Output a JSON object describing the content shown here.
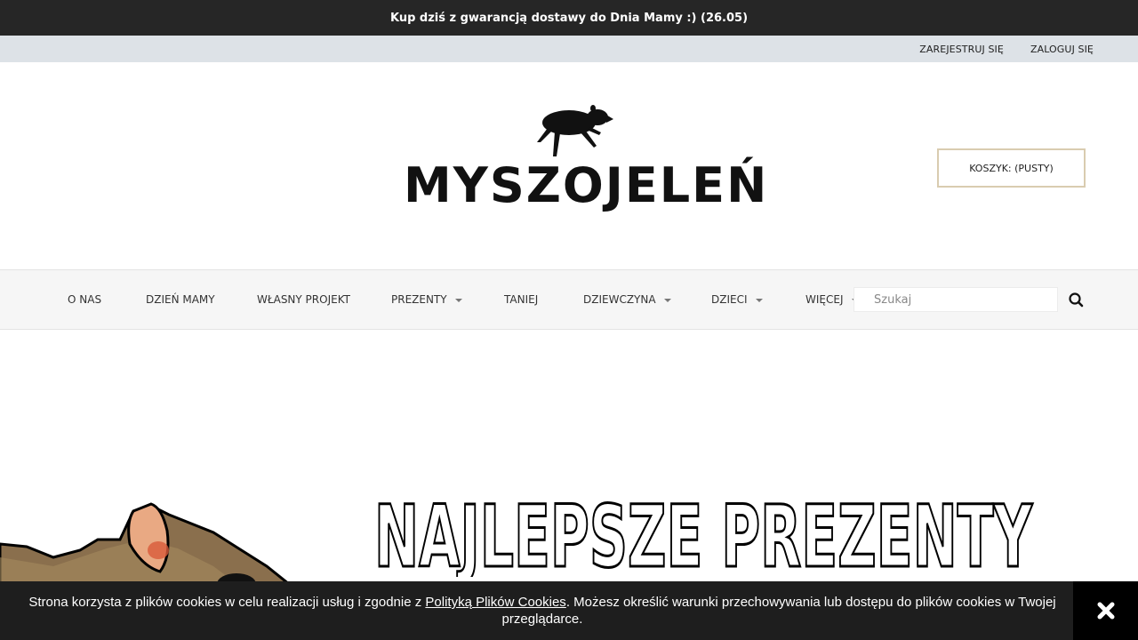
{
  "promo": {
    "text": "Kup dziś z gwarancją dostawy do Dnia Mamy :) (26.05)"
  },
  "account": {
    "register": "ZAREJESTRUJ SIĘ",
    "login": "ZALOGUJ SIĘ"
  },
  "header": {
    "logo_text": "MYSZOJELEŃ",
    "cart_label": "KOSZYK: (PUSTY)"
  },
  "nav": {
    "items": [
      {
        "label": "O NAS",
        "has_dropdown": false
      },
      {
        "label": "DZIEŃ MAMY",
        "has_dropdown": false
      },
      {
        "label": "WŁASNY PROJEKT",
        "has_dropdown": false
      },
      {
        "label": "PREZENTY",
        "has_dropdown": true
      },
      {
        "label": "TANIEJ",
        "has_dropdown": false
      },
      {
        "label": "DZIEWCZYNA",
        "has_dropdown": true
      },
      {
        "label": "DZIECI",
        "has_dropdown": true
      },
      {
        "label": "WIĘCEJ",
        "has_dropdown": true
      }
    ],
    "search_placeholder": "Szukaj",
    "search_icon": "search-icon"
  },
  "hero": {
    "headline": "NAJLEPSZE PREZENTY"
  },
  "cookie": {
    "text_before": "Strona korzysta z plików cookies w celu realizacji usług i zgodnie z ",
    "link_text": "Polityką Plików Cookies",
    "text_after": ". Możesz określić warunki przechowywania lub dostępu do plików cookies w Twojej przeglądarce.",
    "close_icon": "close-icon"
  },
  "colors": {
    "dark": "#262626",
    "account_bar": "#dde2e7",
    "cart_border": "#d9ccb0",
    "nav_bg": "#f6f6f6",
    "cookie_bg": "#1e1e1e"
  }
}
